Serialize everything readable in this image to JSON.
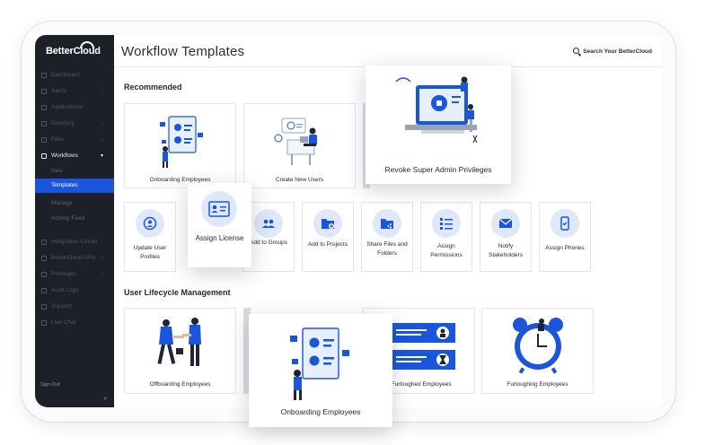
{
  "sidebar": {
    "logo": "BetterCloud",
    "items": [
      {
        "label": "Dashboard"
      },
      {
        "label": "Alerts"
      },
      {
        "label": "Applications"
      },
      {
        "label": "Directory"
      },
      {
        "label": "Files"
      },
      {
        "label": "Workflows"
      },
      {
        "label": "Integration Center"
      },
      {
        "label": "BetterCloud APIs"
      },
      {
        "label": "Privileges"
      },
      {
        "label": "Audit Logs"
      },
      {
        "label": "Support"
      },
      {
        "label": "Live Chat"
      }
    ],
    "workflow_sub": [
      {
        "label": "New"
      },
      {
        "label": "Templates"
      },
      {
        "label": "Manage"
      },
      {
        "label": "Activity Feed"
      }
    ],
    "sign_out": "Sign Out",
    "collapse": "«"
  },
  "header": {
    "title": "Workflow Templates",
    "search_label": "Search Your BetterCloud"
  },
  "sections": {
    "recommended": "Recommended",
    "lifecycle": "User Lifecycle Management"
  },
  "recommended_cards": [
    {
      "label": "Onboarding Employees"
    },
    {
      "label": "Create New Users"
    }
  ],
  "small_cards": [
    {
      "label": "Update User Profiles",
      "icon": "user-refresh-icon"
    },
    {
      "label": "Add to Groups",
      "icon": "group-icon"
    },
    {
      "label": "Add to Projects",
      "icon": "folder-plus-icon"
    },
    {
      "label": "Share Files and Folders",
      "icon": "folder-share-icon"
    },
    {
      "label": "Assign Permissions",
      "icon": "checklist-icon"
    },
    {
      "label": "Notify Stakeholders",
      "icon": "mail-icon"
    },
    {
      "label": "Assign Phones",
      "icon": "phone-icon"
    }
  ],
  "lifecycle_cards": [
    {
      "label": "Offboarding Employees"
    },
    {
      "label": "e Furloughed Employees"
    },
    {
      "label": "Furloughing Employees"
    }
  ],
  "floating": {
    "revoke": "Revoke Super Admin Privileges",
    "assign_license": "Assign License",
    "onboarding": "Onboarding Employees"
  },
  "colors": {
    "accent": "#1a56db",
    "sidebar_bg": "#1d2029",
    "icon_circle": "#dfe8fb"
  }
}
